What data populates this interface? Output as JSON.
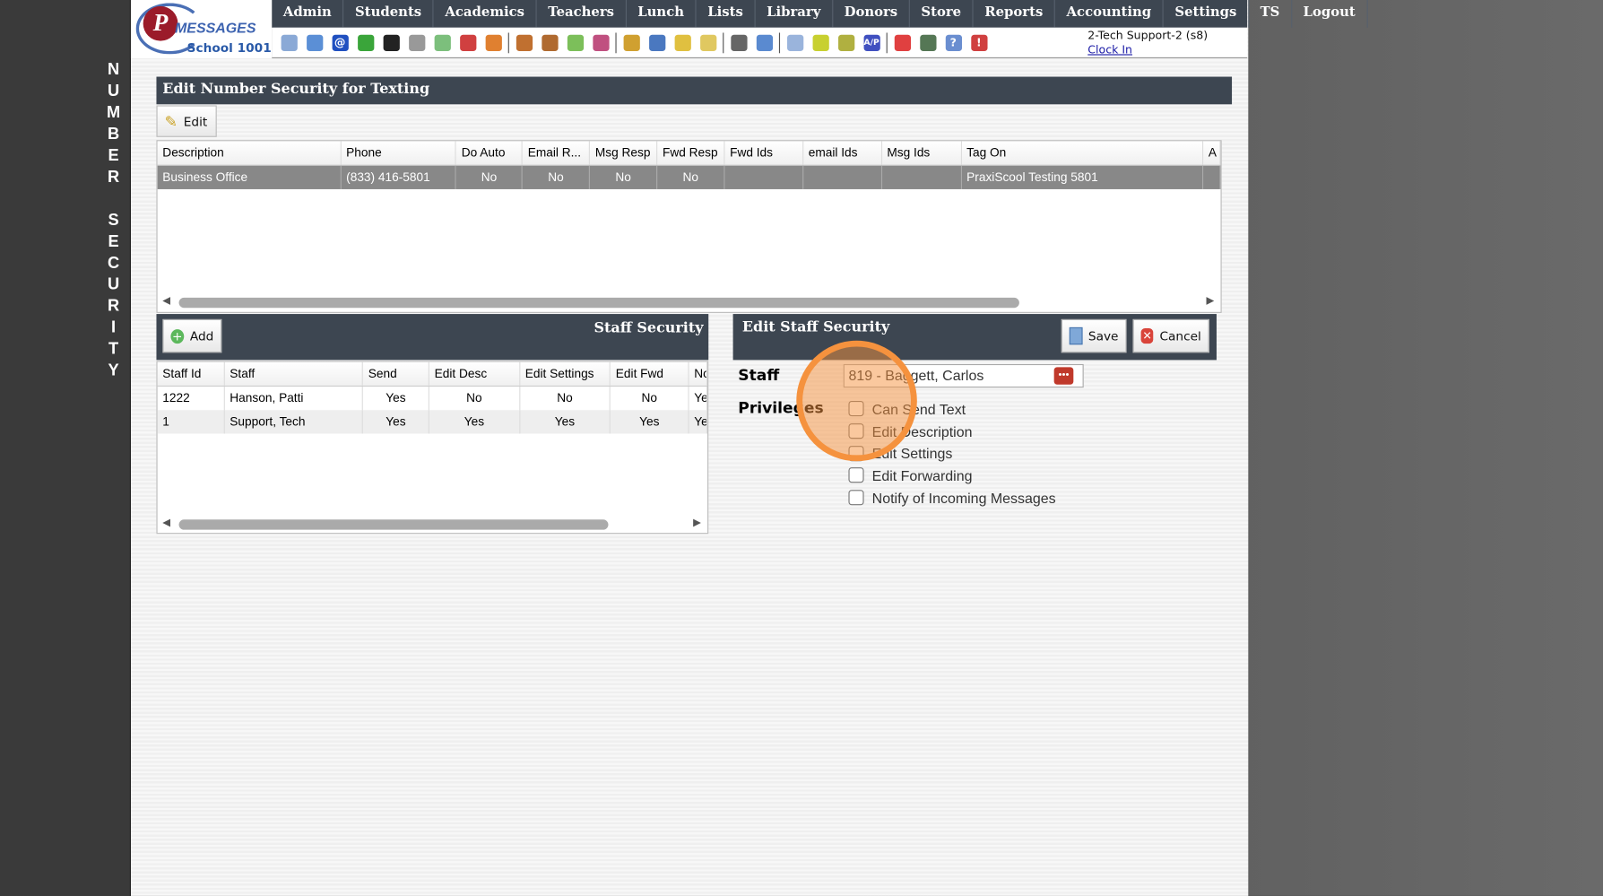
{
  "vertical_title": "NUMBER SECURITY",
  "logo": {
    "brand": "PS MESSAGES",
    "school": "School 1001"
  },
  "nav": [
    "Admin",
    "Students",
    "Academics",
    "Teachers",
    "Lunch",
    "Lists",
    "Library",
    "Donors",
    "Store",
    "Reports",
    "Accounting",
    "Settings",
    "TS",
    "Logout"
  ],
  "toolbar_icons": [
    {
      "name": "search-icon",
      "color": "#8aa9d6"
    },
    {
      "name": "calendar-grid-icon",
      "color": "#5b8fd6"
    },
    {
      "name": "email-at-icon",
      "color": "#2050c0",
      "glyph": "@"
    },
    {
      "name": "chat-add-icon",
      "color": "#3aa53a"
    },
    {
      "name": "mobile-phone-icon",
      "color": "#222"
    },
    {
      "name": "speaker-icon",
      "color": "#999"
    },
    {
      "name": "schedule-icon",
      "color": "#7cbf7c"
    },
    {
      "name": "date-calendar-icon",
      "color": "#d04040"
    },
    {
      "name": "megaphone-icon",
      "color": "#e08030"
    },
    "sep",
    {
      "name": "add-student-icon",
      "color": "#c07030"
    },
    {
      "name": "student-icon",
      "color": "#b06a30"
    },
    {
      "name": "money-icon",
      "color": "#7cbf5a"
    },
    {
      "name": "parents-icon",
      "color": "#c05080"
    },
    "sep",
    {
      "name": "lunch-burger-icon",
      "color": "#d0a030"
    },
    {
      "name": "book-icon",
      "color": "#4a78c0"
    },
    {
      "name": "bell-icon",
      "color": "#e0c040"
    },
    {
      "name": "export-note-icon",
      "color": "#e0c860"
    },
    "sep",
    {
      "name": "teacher-icon",
      "color": "#666"
    },
    {
      "name": "alarm-clock-icon",
      "color": "#5a8ad0"
    },
    "sep",
    {
      "name": "spreadsheet-icon",
      "color": "#9ab4dc"
    },
    {
      "name": "card-icon",
      "color": "#c8d030"
    },
    {
      "name": "print-check-icon",
      "color": "#b0b040"
    },
    {
      "name": "accounts-payable-icon",
      "color": "#4050c0",
      "glyph": "A/P"
    },
    "sep",
    {
      "name": "pdf-icon",
      "color": "#e04040"
    },
    {
      "name": "cash-register-icon",
      "color": "#557755"
    },
    {
      "name": "help-icon",
      "color": "#6a8ed0",
      "glyph": "?"
    },
    {
      "name": "stop-icon",
      "color": "#d04040",
      "glyph": "!"
    }
  ],
  "user": {
    "name": "2-Tech Support-2 (s8)",
    "clock_in": "Clock In"
  },
  "numbers_panel": {
    "title": "Edit Number Security for Texting",
    "edit_label": "Edit",
    "columns": [
      "Description",
      "Phone",
      "Do Auto",
      "Email R...",
      "Msg Resp",
      "Fwd Resp",
      "Fwd Ids",
      "email Ids",
      "Msg Ids",
      "Tag On",
      "A"
    ],
    "rows": [
      [
        "Business Office",
        "(833) 416-5801",
        "No",
        "No",
        "No",
        "No",
        "",
        "",
        "",
        "PraxiScool Testing 5801",
        ""
      ]
    ]
  },
  "staff_panel": {
    "title": "Staff Security",
    "add_label": "Add",
    "columns": [
      "Staff Id",
      "Staff",
      "Send",
      "Edit Desc",
      "Edit Settings",
      "Edit Fwd",
      "No"
    ],
    "rows": [
      [
        "1222",
        "Hanson, Patti",
        "Yes",
        "No",
        "No",
        "No",
        "Yes"
      ],
      [
        "1",
        "Support, Tech",
        "Yes",
        "Yes",
        "Yes",
        "Yes",
        "Yes"
      ]
    ]
  },
  "edit_staff": {
    "title": "Edit Staff Security",
    "save_label": "Save",
    "cancel_label": "Cancel",
    "staff_label": "Staff",
    "staff_value": "819 - Baggett, Carlos",
    "privileges_label": "Privileges",
    "privileges": [
      {
        "label": "Can Send Text",
        "checked": false
      },
      {
        "label": "Edit Description",
        "checked": false
      },
      {
        "label": "Edit Settings",
        "checked": false
      },
      {
        "label": "Edit Forwarding",
        "checked": false
      },
      {
        "label": "Notify of Incoming Messages",
        "checked": false
      }
    ]
  },
  "colors": {
    "header_bar": "#3d4651",
    "selected_row": "#888888",
    "highlight": "#f5923e"
  }
}
